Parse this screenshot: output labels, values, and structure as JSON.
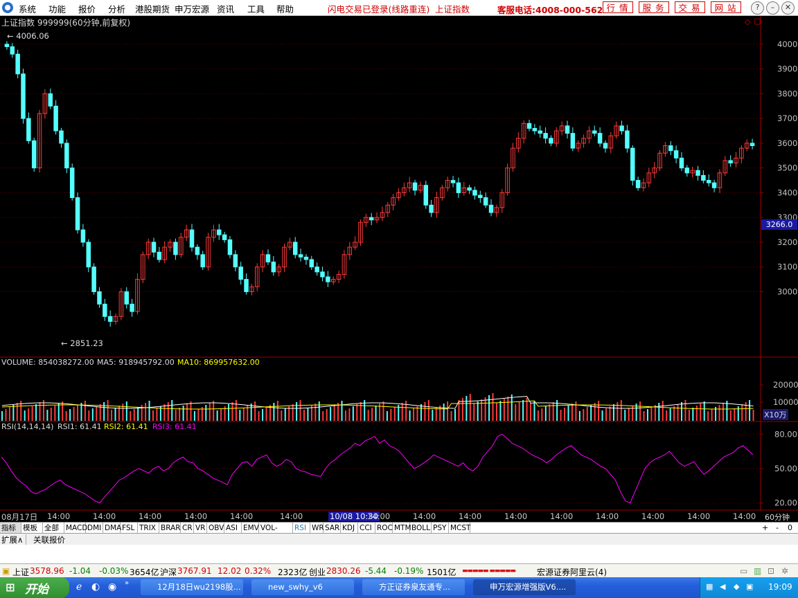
{
  "menu": {
    "items": [
      "系统",
      "功能",
      "报价",
      "分析",
      "港股期货",
      "申万宏源",
      "资讯",
      "工具",
      "帮助"
    ],
    "status": "闪电交易已登录(线路重连)",
    "index_name": "上证指数",
    "phone": "客服电话:4008-000-562",
    "buttons": [
      "行情",
      "服务",
      "交易",
      "网站"
    ]
  },
  "chart": {
    "title": "上证指数 999999(60分钟,前复权)",
    "high_label": "4006.06",
    "low_label": "2851.23",
    "current_price": "3266.0",
    "price_ticks": [
      "4000",
      "3900",
      "3800",
      "3700",
      "3600",
      "3500",
      "3400",
      "3300",
      "3200",
      "3100",
      "3000"
    ],
    "volume_title": "VOLUME: 854038272.00",
    "ma5": "MA5: 918945792.00",
    "ma10": "MA10: 869957632.00",
    "volume_ticks": [
      "20000",
      "10000"
    ],
    "volume_unit": "X10万",
    "rsi_label": "RSI(14,14,14)",
    "rsi1": "RSI1: 61.41",
    "rsi2": "RSI2: 61.41",
    "rsi3": "RSI3: 61.41",
    "rsi_ticks": [
      "80.00",
      "50.00",
      "20.00"
    ],
    "time_labels": [
      "08月17日",
      "14:00",
      "14:00",
      "14:00",
      "14:00",
      "14:00",
      "14:00",
      "10/08 10:30",
      "14:00",
      "14:00",
      "14:00",
      "14:00",
      "14:00",
      "14:00",
      "14:00",
      "14:00",
      "14:00",
      "14:00",
      "14:00",
      "14:00",
      "14:00"
    ],
    "period": "60分钟",
    "colors": {
      "up": "#ff3c3c",
      "down": "#54ffff",
      "ma5": "#ffffff",
      "ma10": "#ffff00",
      "rsi": "#ff00ff"
    }
  },
  "chart_data": {
    "type": "candlestick",
    "ylim": [
      2800,
      4050
    ],
    "closes": [
      3990,
      3960,
      3880,
      3700,
      3610,
      3500,
      3720,
      3800,
      3750,
      3650,
      3600,
      3500,
      3380,
      3250,
      3200,
      3100,
      3000,
      2950,
      2900,
      2880,
      2900,
      3000,
      2950,
      2920,
      3050,
      3150,
      3200,
      3160,
      3130,
      3180,
      3200,
      3150,
      3220,
      3250,
      3180,
      3150,
      3100,
      3220,
      3250,
      3230,
      3210,
      3150,
      3100,
      3050,
      3000,
      3020,
      3100,
      3150,
      3120,
      3080,
      3100,
      3180,
      3200,
      3150,
      3140,
      3130,
      3100,
      3080,
      3060,
      3040,
      3050,
      3070,
      3150,
      3180,
      3200,
      3280,
      3300,
      3290,
      3300,
      3320,
      3350,
      3380,
      3400,
      3420,
      3440,
      3410,
      3430,
      3350,
      3320,
      3380,
      3420,
      3450,
      3440,
      3400,
      3420,
      3410,
      3390,
      3380,
      3350,
      3320,
      3340,
      3400,
      3500,
      3580,
      3620,
      3680,
      3660,
      3650,
      3640,
      3620,
      3600,
      3650,
      3670,
      3640,
      3580,
      3600,
      3620,
      3650,
      3640,
      3600,
      3580,
      3630,
      3670,
      3650,
      3580,
      3450,
      3420,
      3440,
      3480,
      3500,
      3560,
      3590,
      3570,
      3540,
      3500,
      3480,
      3490,
      3470,
      3450,
      3440,
      3420,
      3480,
      3530,
      3520,
      3540,
      3580,
      3600,
      3590
    ],
    "volume_ma": true,
    "rsi_ylim": [
      15,
      85
    ],
    "rsi": [
      60,
      55,
      48,
      42,
      38,
      35,
      30,
      28,
      30,
      32,
      35,
      38,
      40,
      36,
      34,
      32,
      30,
      28,
      25,
      22,
      20,
      25,
      30,
      35,
      40,
      42,
      45,
      48,
      50,
      48,
      46,
      50,
      52,
      48,
      50,
      55,
      58,
      60,
      56,
      55,
      50,
      48,
      45,
      42,
      40,
      38,
      36,
      45,
      50,
      55,
      56,
      52,
      58,
      60,
      62,
      55,
      52,
      54,
      58,
      56,
      50,
      48,
      47,
      45,
      44,
      43,
      50,
      55,
      58,
      62,
      65,
      68,
      72,
      70,
      74,
      76,
      78,
      72,
      75,
      70,
      68,
      65,
      60,
      55,
      50,
      52,
      55,
      58,
      62,
      60,
      58,
      56,
      54,
      52,
      55,
      50,
      48,
      52,
      60,
      65,
      70,
      78,
      80,
      76,
      72,
      70,
      68,
      65,
      62,
      60,
      58,
      55,
      58,
      62,
      65,
      68,
      70,
      66,
      62,
      60,
      58,
      55,
      52,
      50,
      45,
      40,
      30,
      22,
      20,
      30,
      40,
      50,
      55,
      58,
      60,
      62,
      65,
      60,
      55,
      52,
      54,
      56,
      50,
      45,
      48,
      52,
      56,
      60,
      62,
      64,
      68,
      70,
      66,
      62
    ]
  },
  "indicators": [
    "指标",
    "模板",
    "全部",
    "MACD",
    "DMI",
    "DMA",
    "FSL",
    "TRIX",
    "BRAR",
    "CR",
    "VR",
    "OBV",
    "ASI",
    "EMV",
    "VOL-TDX",
    "RSI",
    "WR",
    "SAR",
    "KDJ",
    "CCI",
    "ROC",
    "MTM",
    "BOLL",
    "PSY",
    "MCST"
  ],
  "ext_tabs": [
    "扩展∧",
    "关联报价"
  ],
  "status_bar": {
    "sh_label": "上证",
    "sh_value": "3578.96",
    "sh_change": "-1.04",
    "sh_pct": "-0.03%",
    "sh_amount": "3654亿",
    "hs_label": "沪深",
    "hs_value": "3767.91",
    "hs_change": "12.02",
    "hs_pct": "0.32%",
    "hs_amount": "2323亿",
    "cy_label": "创业",
    "cy_value": "2830.26",
    "cy_change": "-5.44",
    "cy_pct": "-0.19%",
    "cy_amount": "1501亿",
    "server": "宏源证券阿里云(4)"
  },
  "taskbar": {
    "start": "开始",
    "tasks": [
      "12月18日wu2198股...",
      "new_swhy_v6",
      "方正证券泉友通专...",
      "申万宏源增强版V6...."
    ],
    "clock": "19:09"
  }
}
